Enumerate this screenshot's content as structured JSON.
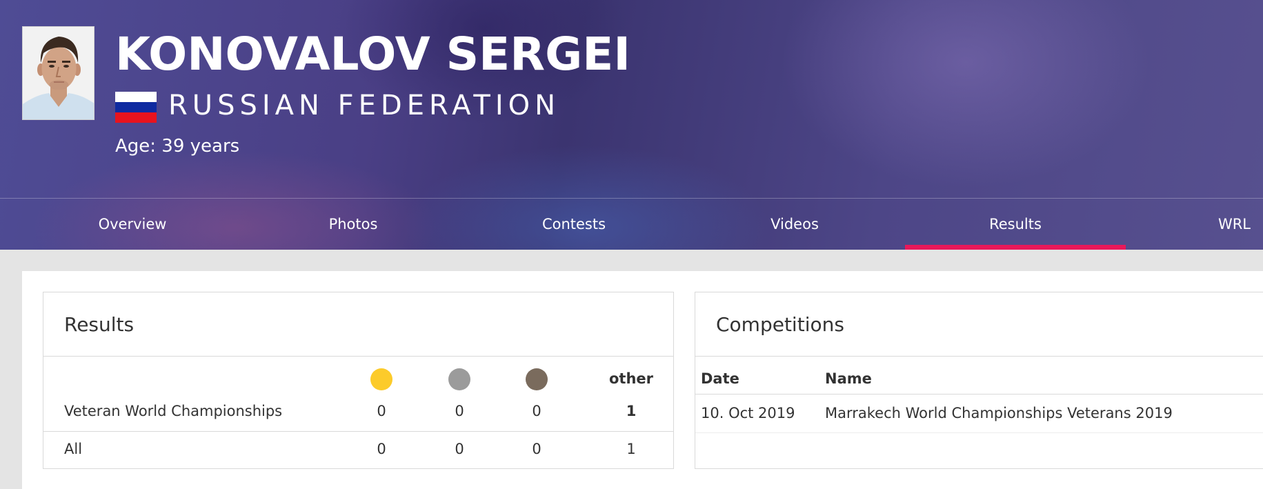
{
  "athlete": {
    "name": "KONOVALOV SERGEI",
    "country": "RUSSIAN FEDERATION",
    "age": "Age: 39 years",
    "flag_colors": [
      "#ffffff",
      "#0f2aa0",
      "#e8131e"
    ]
  },
  "nav": {
    "tabs": [
      {
        "label": "Overview"
      },
      {
        "label": "Photos"
      },
      {
        "label": "Contests"
      },
      {
        "label": "Videos"
      },
      {
        "label": "Results",
        "active": true
      },
      {
        "label": "WRL"
      }
    ],
    "active_color": "#e8185a"
  },
  "results": {
    "title": "Results",
    "medals": [
      {
        "icon": "gold-medal-icon",
        "color": "#fccb2a"
      },
      {
        "icon": "silver-medal-icon",
        "color": "#9b9b9b"
      },
      {
        "icon": "bronze-medal-icon",
        "color": "#7a6b5d"
      }
    ],
    "other_label": "other",
    "rows": [
      {
        "label": "Veteran World Championships",
        "gold": "0",
        "silver": "0",
        "bronze": "0",
        "other": "1"
      },
      {
        "label": "All",
        "gold": "0",
        "silver": "0",
        "bronze": "0",
        "other": "1"
      }
    ]
  },
  "competitions": {
    "title": "Competitions",
    "columns": [
      "Date",
      "Name"
    ],
    "rows": [
      {
        "date": "10. Oct 2019",
        "name": "Marrakech World Championships Veterans 2019"
      }
    ]
  }
}
